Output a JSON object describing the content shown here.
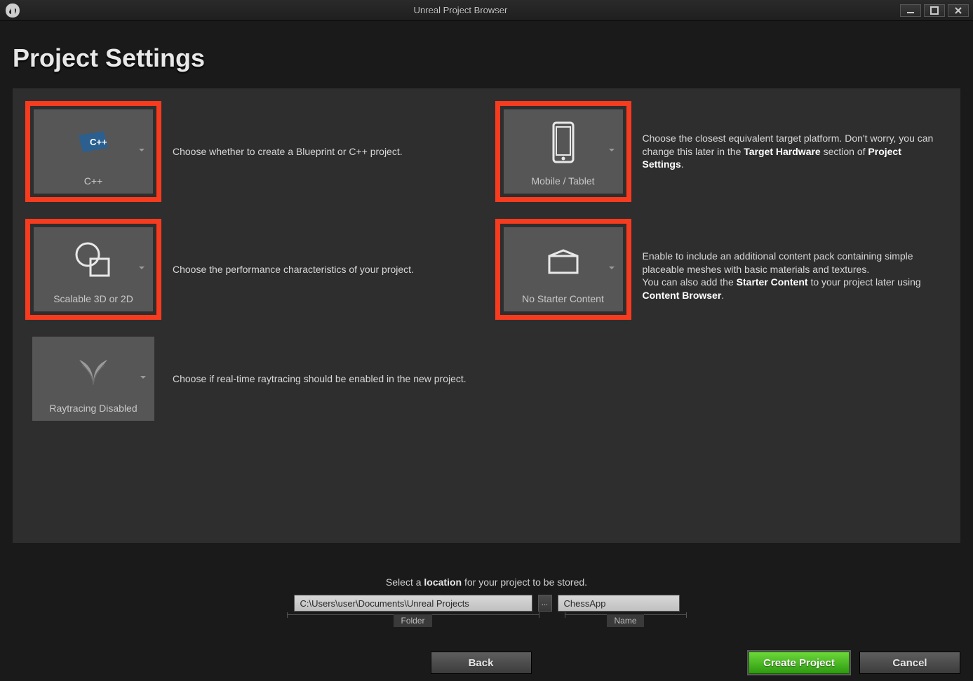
{
  "window": {
    "title": "Unreal Project Browser"
  },
  "page": {
    "heading": "Project Settings"
  },
  "options": {
    "cpp": {
      "label": "C++",
      "desc": "Choose whether to create a Blueprint or C++ project."
    },
    "platform": {
      "label": "Mobile / Tablet",
      "desc_pre": "Choose the closest equivalent target platform. Don't worry, you can change this later in the ",
      "desc_b1": "Target Hardware",
      "desc_mid": " section of ",
      "desc_b2": "Project Settings",
      "desc_post": "."
    },
    "scalable": {
      "label": "Scalable 3D or 2D",
      "desc": "Choose the performance characteristics of your project."
    },
    "starter": {
      "label": "No Starter Content",
      "desc_pre": "Enable to include an additional content pack containing simple placeable meshes with basic materials and textures.\nYou can also add the ",
      "desc_b1": "Starter Content",
      "desc_mid": " to your project later using ",
      "desc_b2": "Content Browser",
      "desc_post": "."
    },
    "raytracing": {
      "label": "Raytracing Disabled",
      "desc": "Choose if real-time raytracing should be enabled in the new project."
    }
  },
  "footer": {
    "loc_pre": "Select a ",
    "loc_b": "location",
    "loc_post": " for your project to be stored.",
    "folder_value": "C:\\Users\\user\\Documents\\Unreal Projects",
    "folder_label": "Folder",
    "name_value": "ChessApp",
    "name_label": "Name",
    "browse_label": "...",
    "back": "Back",
    "create": "Create Project",
    "cancel": "Cancel"
  }
}
